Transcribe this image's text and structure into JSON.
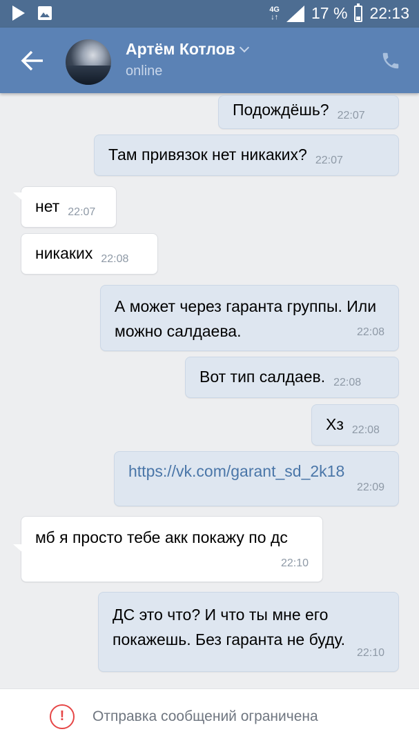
{
  "status_bar": {
    "network": "4G",
    "battery": "17 %",
    "time": "22:13"
  },
  "header": {
    "contact_name": "Артём Котлов",
    "contact_status": "online"
  },
  "messages": [
    {
      "dir": "out",
      "text": "Подождёшь?",
      "time": "22:07"
    },
    {
      "dir": "out",
      "text": "Там привязок нет никаких?",
      "time": "22:07"
    },
    {
      "dir": "in",
      "text": "нет",
      "time": "22:07"
    },
    {
      "dir": "in",
      "text": "никаких",
      "time": "22:08"
    },
    {
      "dir": "out",
      "text": "А может через гаранта группы. Или можно салдаева.",
      "time": "22:08"
    },
    {
      "dir": "out",
      "text": "Вот тип салдаев.",
      "time": "22:08"
    },
    {
      "dir": "out",
      "text": "Хз",
      "time": "22:08"
    },
    {
      "dir": "out",
      "text": "https://vk.com/garant_sd_2k18",
      "time": "22:09"
    },
    {
      "dir": "in",
      "text": "мб я просто тебе акк покажу по дс",
      "time": "22:10"
    },
    {
      "dir": "out",
      "text": "ДС это что? И что ты мне его покажешь. Без гаранта не буду.",
      "time": "22:10"
    }
  ],
  "footer": {
    "restriction_text": "Отправка сообщений ограничена",
    "icon": "exclamation-circle-icon"
  },
  "colors": {
    "header": "#5b82b5",
    "status_bar": "#4d6d92",
    "outgoing_bubble": "#dee6f0",
    "incoming_bubble": "#ffffff",
    "link": "#4a76a8",
    "warning": "#e64646"
  }
}
